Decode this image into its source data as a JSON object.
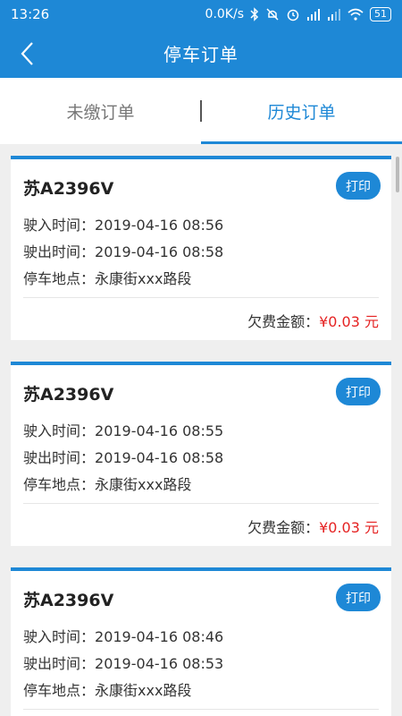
{
  "status_bar": {
    "time": "13:26",
    "speed": "0.0K/s",
    "battery": "51"
  },
  "header": {
    "title": "停车订单"
  },
  "tabs": [
    {
      "label": "未缴订单",
      "active": false
    },
    {
      "label": "历史订单",
      "active": true
    }
  ],
  "labels": {
    "enter": "驶入时间：",
    "exit": "驶出时间：",
    "location": "停车地点：",
    "fee": "欠费金额：",
    "print": "打印"
  },
  "orders": [
    {
      "plate": "苏A2396V",
      "enter_time": "2019-04-16 08:56",
      "exit_time": "2019-04-16 08:58",
      "location": "永康街xxx路段",
      "fee": "¥0.03 元"
    },
    {
      "plate": "苏A2396V",
      "enter_time": "2019-04-16 08:55",
      "exit_time": "2019-04-16 08:58",
      "location": "永康街xxx路段",
      "fee": "¥0.03 元"
    },
    {
      "plate": "苏A2396V",
      "enter_time": "2019-04-16 08:46",
      "exit_time": "2019-04-16 08:53",
      "location": "永康街xxx路段",
      "fee": ""
    }
  ],
  "colors": {
    "primary": "#1e88d6",
    "fee": "#e52222"
  }
}
